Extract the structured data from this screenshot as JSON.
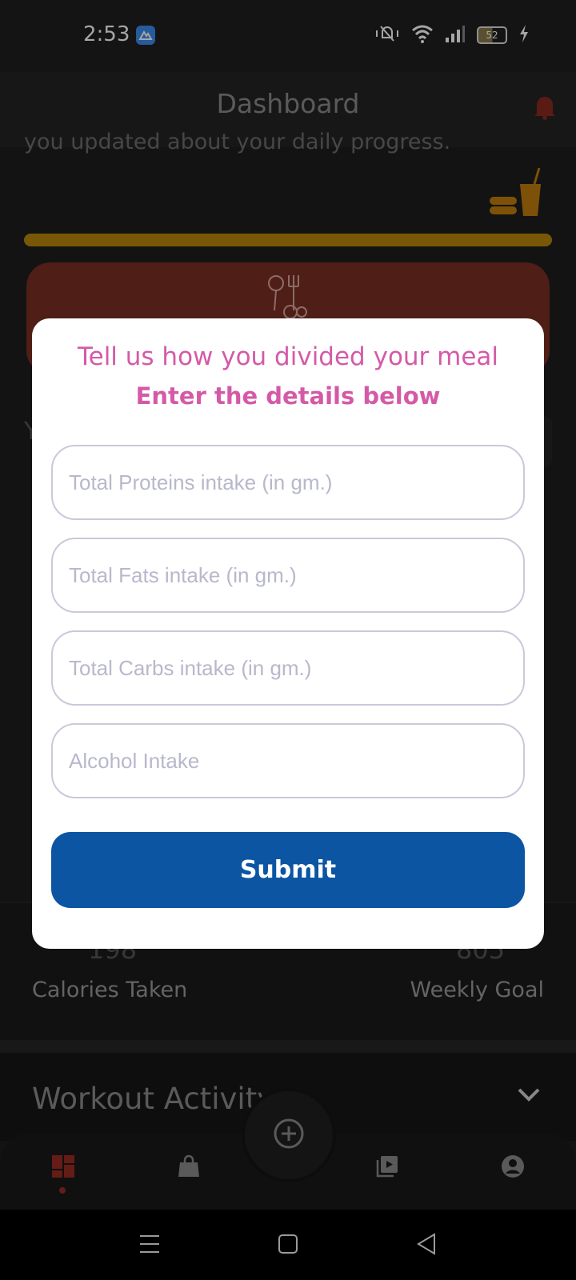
{
  "status_bar": {
    "time": "2:53",
    "battery_level": "52",
    "icons": [
      "app-notification-icon",
      "mute-vibrate-icon",
      "wifi-icon",
      "signal-icon",
      "battery-icon",
      "charging-icon"
    ]
  },
  "header": {
    "title": "Dashboard",
    "bell_icon": "bell-icon",
    "accent_color": "#c0392b"
  },
  "background": {
    "progress_text": "you updated about your daily progress.",
    "progress_fraction": 1.0,
    "partial_letter": "Y",
    "calories_taken_label": "Calories Taken",
    "calories_taken_value": "198",
    "weekly_goal_label": "Weekly Goal",
    "weekly_goal_value": "805",
    "workout_title": "Workout Activity"
  },
  "dialog": {
    "title": "Tell us how you divided your meal",
    "subtitle": "Enter the details below",
    "fields": {
      "proteins_placeholder": "Total Proteins intake (in gm.)",
      "fats_placeholder": "Total Fats intake (in gm.)",
      "carbs_placeholder": "Total Carbs intake (in gm.)",
      "alcohol_placeholder": "Alcohol Intake"
    },
    "submit_label": "Submit",
    "title_color": "#d45aa7",
    "button_color": "#0b55a3"
  },
  "bottom_nav": {
    "items": [
      "dashboard-icon",
      "shop-bag-icon",
      "add-circle-icon",
      "video-library-icon",
      "profile-icon"
    ],
    "active": "dashboard-icon"
  },
  "system_nav": [
    "menu-icon",
    "home-icon",
    "back-icon"
  ]
}
